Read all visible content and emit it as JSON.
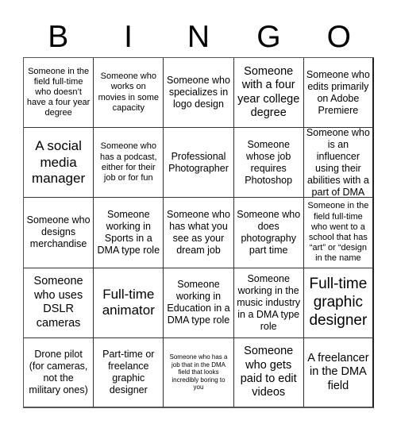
{
  "title_letters": [
    "B",
    "I",
    "N",
    "G",
    "O"
  ],
  "board": {
    "rows": [
      [
        {
          "text": "Someone in the field full-time who doesn’t have a four year degree",
          "size": "sm"
        },
        {
          "text": "Someone who works on movies in some capacity",
          "size": "sm"
        },
        {
          "text": "Someone who specializes in logo design",
          "size": "md"
        },
        {
          "text": "Someone with a four year college degree",
          "size": "lg"
        },
        {
          "text": "Someone who edits primarily on Adobe Premiere",
          "size": "md"
        }
      ],
      [
        {
          "text": "A social media manager",
          "size": "xl"
        },
        {
          "text": "Someone who has a podcast, either for their job or for fun",
          "size": "sm"
        },
        {
          "text": "Professional Photographer",
          "size": "md"
        },
        {
          "text": "Someone whose job requires Photoshop",
          "size": "md"
        },
        {
          "text": "Someone who is an influencer using their abilities with a part of DMA",
          "size": "md"
        }
      ],
      [
        {
          "text": "Someone who designs merchandise",
          "size": "md"
        },
        {
          "text": "Someone working in Sports in a DMA type role",
          "size": "md"
        },
        {
          "text": "Someone who has what you see as your dream job",
          "size": "md"
        },
        {
          "text": "Someone who does photography part time",
          "size": "md"
        },
        {
          "text": "Someone in the field full-time who went to a school that has “art” or “design in the name",
          "size": "sm"
        }
      ],
      [
        {
          "text": "Someone who uses DSLR cameras",
          "size": "lg"
        },
        {
          "text": "Full-time animator",
          "size": "xl"
        },
        {
          "text": "Someone working in Education in a DMA type role",
          "size": "md"
        },
        {
          "text": "Someone working in the music industry in a DMA type role",
          "size": "md"
        },
        {
          "text": "Full-time graphic designer",
          "size": "xxl"
        }
      ],
      [
        {
          "text": "Drone pilot (for cameras, not the military ones)",
          "size": "md"
        },
        {
          "text": "Part-time or freelance graphic designer",
          "size": "md"
        },
        {
          "text": "Someone who has a job that in the DMA field that looks incredibly boring to you",
          "size": "xs"
        },
        {
          "text": "Someone who gets paid to edit videos",
          "size": "lg"
        },
        {
          "text": "A freelancer in the DMA field",
          "size": "lg"
        }
      ]
    ]
  }
}
